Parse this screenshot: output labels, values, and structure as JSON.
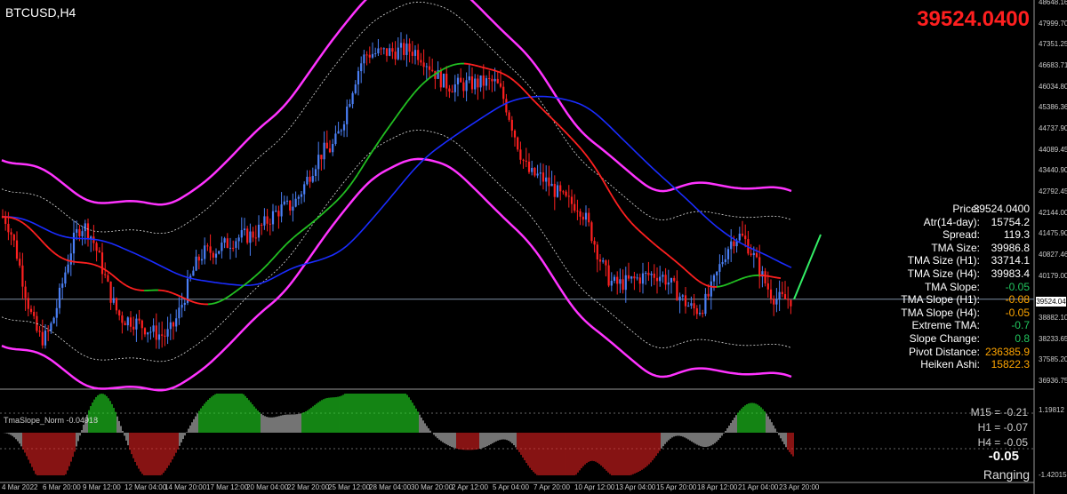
{
  "header": {
    "symbol": "BTCUSD,H4",
    "current_price": "39524.0400"
  },
  "info_panel": [
    {
      "label": "Price:",
      "value": "39524.0400",
      "color": "#ffffff"
    },
    {
      "label": "Atr(14-day):",
      "value": "15754.2",
      "color": "#ffffff"
    },
    {
      "label": "Spread:",
      "value": "119.3",
      "color": "#ffffff"
    },
    {
      "label": "TMA Size:",
      "value": "39986.8",
      "color": "#ffffff"
    },
    {
      "label": "TMA Size (H1):",
      "value": "33714.1",
      "color": "#ffffff"
    },
    {
      "label": "TMA Size (H4):",
      "value": "39983.4",
      "color": "#ffffff"
    },
    {
      "label": "TMA Slope:",
      "value": "-0.05",
      "color": "#22c55e"
    },
    {
      "label": "TMA Slope (H1):",
      "value": "-0.08",
      "color": "#ffa500"
    },
    {
      "label": "TMA Slope (H4):",
      "value": "-0.05",
      "color": "#ffa500"
    },
    {
      "label": "Extreme TMA:",
      "value": "-0.7",
      "color": "#22c55e"
    },
    {
      "label": "Slope Change:",
      "value": "0.8",
      "color": "#22c55e"
    },
    {
      "label": "Pivot Distance:",
      "value": "236385.9",
      "color": "#ffa500"
    },
    {
      "label": "Heiken Ashi:",
      "value": "15822.3",
      "color": "#ffa500"
    }
  ],
  "indicator": {
    "title": "TmaSlope_Norm -0.04918",
    "mtf": [
      "M15 = -0.21",
      "H1 = -0.07",
      "H4 = -0.05"
    ],
    "current": "-0.05",
    "status": "Ranging",
    "scale": {
      "top": "1.19812",
      "bottom": "-1.42015"
    }
  },
  "price_axis": [
    "48648.16",
    "47999.70",
    "47351.25",
    "46683.71",
    "46034.80",
    "45386.36",
    "44737.90",
    "44089.45",
    "43440.90",
    "42792.45",
    "42144.00",
    "41475.90",
    "40827.46",
    "40179.00",
    "39524.04",
    "38882.10",
    "38233.65",
    "37585.20",
    "36936.75"
  ],
  "price_tag": "39524.04",
  "time_axis": [
    "4 Mar 2022",
    "6 Mar 20:00",
    "9 Mar 12:00",
    "12 Mar 04:00",
    "14 Mar 20:00",
    "17 Mar 12:00",
    "20 Mar 04:00",
    "22 Mar 20:00",
    "25 Mar 12:00",
    "28 Mar 04:00",
    "30 Mar 20:00",
    "2 Apr 12:00",
    "5 Apr 04:00",
    "7 Apr 20:00",
    "10 Apr 12:00",
    "13 Apr 04:00",
    "15 Apr 20:00",
    "18 Apr 12:00",
    "21 Apr 04:00",
    "23 Apr 20:00"
  ],
  "colors": {
    "bull": "#4a7ff5",
    "bear": "#ff2020",
    "band": "#ff33ff",
    "mid_up": "#22c022",
    "mid_down": "#ff2020",
    "slow_ma": "#1a2cff",
    "hist_up": "#22dd22",
    "hist_down": "#e02020",
    "hist_flat": "#c0c0c0",
    "projection": "#33ee66"
  },
  "chart_data": {
    "type": "candlestick",
    "symbol": "BTCUSD",
    "timeframe": "H4",
    "ylim": [
      36936.75,
      48648.16
    ],
    "key_points": [
      {
        "date": "4 Mar 2022",
        "price": 42100
      },
      {
        "date": "6 Mar 20:00",
        "price": 38300
      },
      {
        "date": "9 Mar 12:00",
        "price": 41800
      },
      {
        "date": "12 Mar 04:00",
        "price": 38900
      },
      {
        "date": "14 Mar 20:00",
        "price": 38400
      },
      {
        "date": "17 Mar 12:00",
        "price": 41000
      },
      {
        "date": "20 Mar 04:00",
        "price": 41500
      },
      {
        "date": "22 Mar 20:00",
        "price": 42400
      },
      {
        "date": "25 Mar 12:00",
        "price": 44200
      },
      {
        "date": "28 Mar 04:00",
        "price": 47200
      },
      {
        "date": "30 Mar 20:00",
        "price": 47300
      },
      {
        "date": "2 Apr 12:00",
        "price": 46200
      },
      {
        "date": "5 Apr 04:00",
        "price": 46300
      },
      {
        "date": "7 Apr 20:00",
        "price": 43400
      },
      {
        "date": "10 Apr 12:00",
        "price": 42500
      },
      {
        "date": "13 Apr 04:00",
        "price": 40000
      },
      {
        "date": "15 Apr 20:00",
        "price": 40300
      },
      {
        "date": "18 Apr 12:00",
        "price": 39200
      },
      {
        "date": "21 Apr 04:00",
        "price": 41500
      },
      {
        "date": "23 Apr 20:00",
        "price": 39524
      }
    ]
  }
}
